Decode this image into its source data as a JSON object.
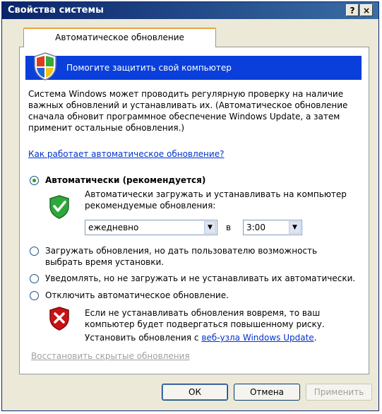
{
  "window": {
    "title": "Свойства системы",
    "help_btn": "?",
    "close_btn": "×"
  },
  "tab": {
    "label": "Автоматическое обновление"
  },
  "banner": {
    "text": "Помогите защитить свой компьютер"
  },
  "intro": {
    "line1": "Система Windows может проводить регулярную проверку на наличие",
    "line2": "важных обновлений и устанавливать их. (Автоматическое обновление",
    "line3": "сначала обновит программное обеспечение Windows Update, а затем",
    "line4": "применит остальные обновления.)"
  },
  "how_link": "Как работает автоматическое обновление?",
  "options": {
    "auto": {
      "label": "Автоматически (рекомендуется)",
      "desc1": "Автоматически загружать и устанавливать на компьютер",
      "desc2": "рекомендуемые обновления:",
      "frequency": "ежедневно",
      "at_label": "в",
      "time": "3:00"
    },
    "download": {
      "line1": "Загружать обновления, но дать пользователю возможность",
      "line2": "выбрать время установки."
    },
    "notify": {
      "label": "Уведомлять, но не загружать и не устанавливать их автоматически."
    },
    "off": {
      "label": "Отключить автоматическое обновление."
    }
  },
  "warning": {
    "line1": "Если не устанавливать обновления вовремя, то ваш",
    "line2": "компьютер будет подвергаться повышенному риску.",
    "line3_prefix": "Установить обновления с ",
    "line3_link": "веб-узла Windows Update",
    "line3_suffix": "."
  },
  "restore_link": "Восстановить скрытые обновления",
  "buttons": {
    "ok": "ОК",
    "cancel": "Отмена",
    "apply": "Применить"
  },
  "colors": {
    "accent": "#0a3fdb",
    "link": "#0033cc",
    "tab_highlight": "#e8a33e",
    "check_green": "#21a121",
    "warning_red": "#cc1111"
  }
}
